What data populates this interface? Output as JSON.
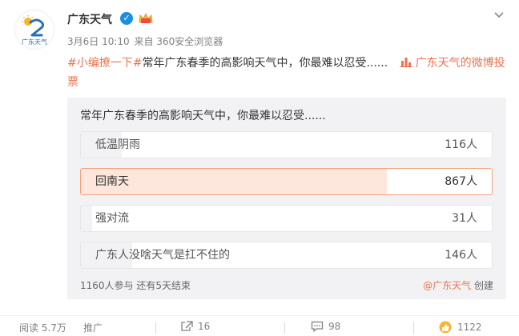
{
  "author": {
    "name": "广东天气",
    "avatar_text": "广东天气"
  },
  "meta": {
    "date": "3月6日 10:10",
    "source": "来自 360安全浏览器"
  },
  "content": {
    "topic": "#小编撩一下#",
    "text": "常年广东春季的高影响天气中，你最难以忍受......",
    "link_text": "广东天气的微博投票"
  },
  "vote": {
    "title": "常年广东春季的高影响天气中，你最难以忍受......",
    "options": [
      {
        "label": "低温阴雨",
        "count": "116人",
        "fraction": 0.0997,
        "selected": false
      },
      {
        "label": "回南天",
        "count": "867人",
        "fraction": 0.7453,
        "selected": true
      },
      {
        "label": "强对流",
        "count": "31人",
        "fraction": 0.0267,
        "selected": false
      },
      {
        "label": "广东人没啥天气是扛不住的",
        "count": "146人",
        "fraction": 0.1255,
        "selected": false
      }
    ],
    "stats": "1160人参与 还有5天结束",
    "creator_link": "@广东天气",
    "creator_suffix": " 创建"
  },
  "footer": {
    "views": "阅读 5.7万",
    "promote": "推广",
    "reposts": "16",
    "comments": "98",
    "likes": "1122"
  },
  "colors": {
    "accent": "#eb7350",
    "selected_fill": "#fde6dc",
    "selected_border": "#f5a17f",
    "verify": "#1d8fe0"
  },
  "icons": [
    "more-chevron-icon",
    "verified-icon",
    "vip-crown-icon",
    "vote-icon",
    "repost-icon",
    "comment-icon",
    "like-icon"
  ]
}
